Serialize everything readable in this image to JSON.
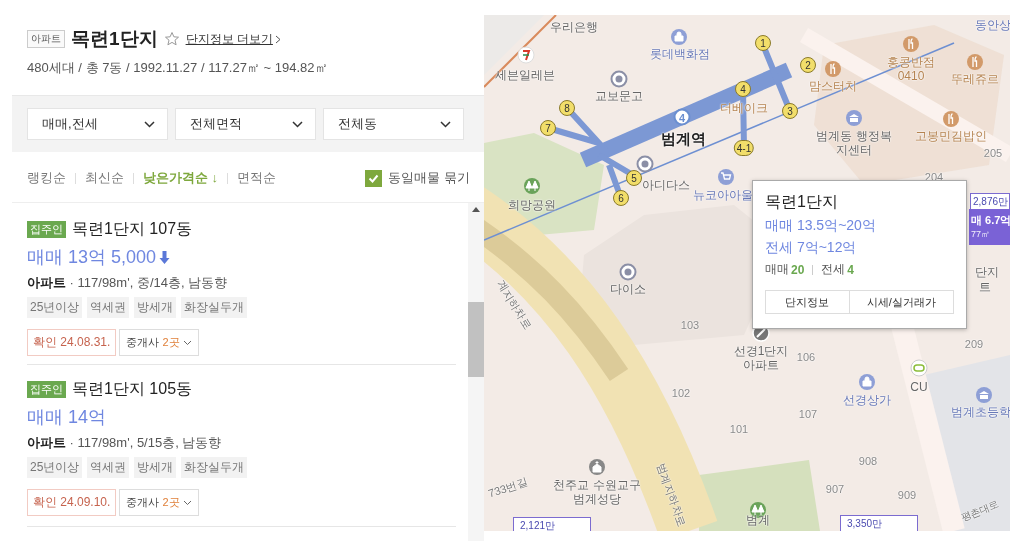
{
  "header": {
    "type_badge": "아파트",
    "title": "목련1단지",
    "favorite": false,
    "info_link": "단지정보 더보기",
    "summary": "480세대 / 총 7동 / 1992.11.27 / 117.27㎡ ~ 194.82㎡"
  },
  "filters": [
    {
      "label": "매매,전세"
    },
    {
      "label": "전체면적"
    },
    {
      "label": "전체동"
    }
  ],
  "sort_options": [
    {
      "label": "랭킹순",
      "selected": false
    },
    {
      "label": "최신순",
      "selected": false
    },
    {
      "label": "낮은가격순 ↓",
      "selected": true
    },
    {
      "label": "면적순",
      "selected": false
    }
  ],
  "group_same": {
    "label": "동일매물 묶기",
    "checked": true
  },
  "listings": [
    {
      "badge": "집주인",
      "title": "목련1단지 107동",
      "price": "매매 13억 5,000",
      "price_down": true,
      "spec": "**아파트** · 117/98m', 중/14층, 남동향",
      "tags": [
        "25년이상",
        "역세권",
        "방세개",
        "화장실두개"
      ],
      "confirmed": "확인 24.08.31.",
      "agents_label": "중개사",
      "agents_count": "2곳"
    },
    {
      "badge": "집주인",
      "title": "목련1단지 105동",
      "price": "매매 14억",
      "price_down": false,
      "spec": "**아파트** · 117/98m', 5/15층, 남동향",
      "tags": [
        "25년이상",
        "역세권",
        "방세개",
        "화장실두개"
      ],
      "confirmed": "확인 24.09.10.",
      "agents_label": "중개사",
      "agents_count": "2곳"
    }
  ],
  "map": {
    "labels": [
      {
        "text": "우리은행",
        "kind": "place"
      },
      {
        "text": "세븐일레븐",
        "kind": "place"
      },
      {
        "text": "롯데백화점",
        "kind": "poi_blue"
      },
      {
        "text": "교보문고",
        "kind": "place"
      },
      {
        "text": "범계역",
        "kind": "station"
      },
      {
        "text": "더베이크",
        "kind": "food"
      },
      {
        "text": "맘스터치",
        "kind": "food"
      },
      {
        "text": "홍콩반점 0410",
        "kind": "food"
      },
      {
        "text": "뚜레쥬르",
        "kind": "food"
      },
      {
        "text": "범계동 행정복지센터",
        "kind": "place"
      },
      {
        "text": "고봉민김밥인",
        "kind": "food"
      },
      {
        "text": "205",
        "kind": "number"
      },
      {
        "text": "204",
        "kind": "number"
      },
      {
        "text": "동안상",
        "kind": "poi_blue"
      },
      {
        "text": "아디다스",
        "kind": "place"
      },
      {
        "text": "뉴코아아울",
        "kind": "poi_blue"
      },
      {
        "text": "희망공원",
        "kind": "place"
      },
      {
        "text": "다이소",
        "kind": "place"
      },
      {
        "text": "103",
        "kind": "number"
      },
      {
        "text": "선경1단지 아파트",
        "kind": "place"
      },
      {
        "text": "106",
        "kind": "number"
      },
      {
        "text": "단지",
        "kind": "place"
      },
      {
        "text": "트",
        "kind": "place"
      },
      {
        "text": "209",
        "kind": "number"
      },
      {
        "text": "계지하차로",
        "kind": "road"
      },
      {
        "text": "102",
        "kind": "number"
      },
      {
        "text": "107",
        "kind": "number"
      },
      {
        "text": "101",
        "kind": "number"
      },
      {
        "text": "선경상가",
        "kind": "poi_blue"
      },
      {
        "text": "CU",
        "kind": "place"
      },
      {
        "text": "범계초등학",
        "kind": "poi_blue"
      },
      {
        "text": "908",
        "kind": "number"
      },
      {
        "text": "907",
        "kind": "number"
      },
      {
        "text": "909",
        "kind": "number"
      },
      {
        "text": "범계",
        "kind": "place"
      },
      {
        "text": "천주교 수원교구 범계성당",
        "kind": "place"
      },
      {
        "text": "733번길",
        "kind": "road"
      },
      {
        "text": "범계지하차로",
        "kind": "road"
      },
      {
        "text": "평촌대로",
        "kind": "road"
      }
    ],
    "station_line": "4",
    "station_exits": [
      {
        "label": "1"
      },
      {
        "label": "2"
      },
      {
        "label": "3"
      },
      {
        "label": "4"
      },
      {
        "label": "4-1"
      },
      {
        "label": "5"
      },
      {
        "label": "6"
      },
      {
        "label": "7"
      },
      {
        "label": "8"
      }
    ],
    "price_markers": [
      {
        "kind": "outline",
        "price": "2,876만"
      },
      {
        "kind": "filled",
        "price": "매 6.7억",
        "area": "77㎡"
      },
      {
        "kind": "outline",
        "price": "2,121만"
      },
      {
        "kind": "stripe",
        "price": "3,350만"
      }
    ],
    "popup": {
      "title": "목련1단지",
      "prices": [
        "매매 13.5억~20억",
        "전세 7억~12억"
      ],
      "counts": [
        {
          "label": "매매",
          "count": "20"
        },
        {
          "label": "전세",
          "count": "4"
        }
      ],
      "buttons": [
        "단지정보",
        "시세/실거래가"
      ]
    }
  }
}
